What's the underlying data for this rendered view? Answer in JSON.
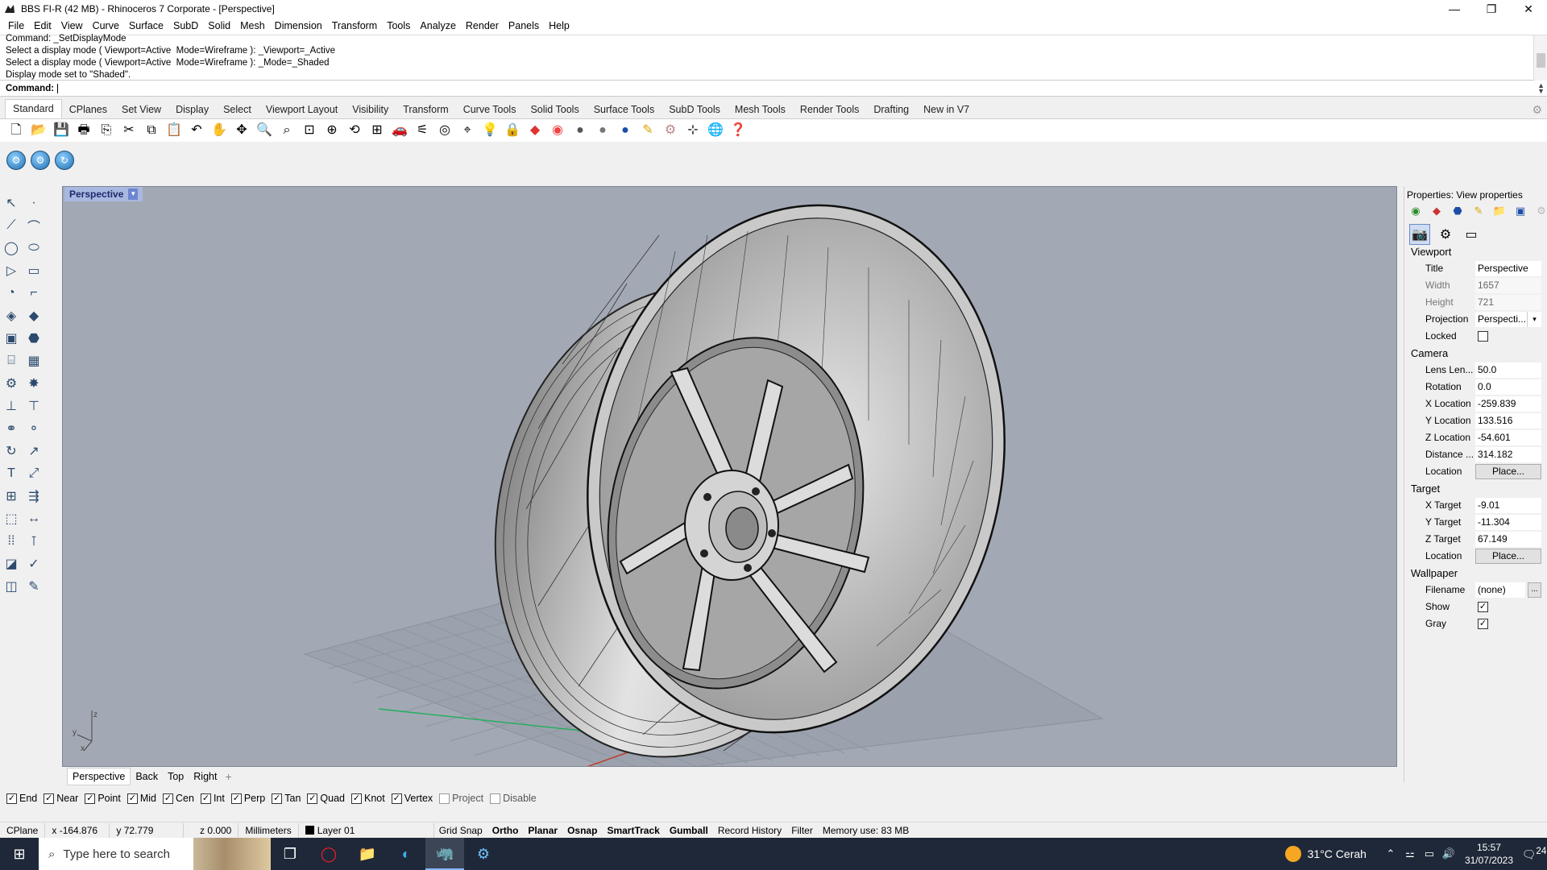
{
  "window": {
    "title": "BBS FI-R (42 MB) - Rhinoceros 7 Corporate - [Perspective]",
    "minimize": "—",
    "maximize": "❐",
    "close": "✕"
  },
  "menu": [
    "File",
    "Edit",
    "View",
    "Curve",
    "Surface",
    "SubD",
    "Solid",
    "Mesh",
    "Dimension",
    "Transform",
    "Tools",
    "Analyze",
    "Render",
    "Panels",
    "Help"
  ],
  "command_history": [
    "Command: _SetDisplayMode",
    "Select a display mode ( Viewport=Active  Mode=Wireframe ): _Viewport=_Active",
    "Select a display mode ( Viewport=Active  Mode=Wireframe ): _Mode=_Shaded",
    "Display mode set to \"Shaded\"."
  ],
  "command_prompt": "Command:",
  "toolbar_tabs": [
    "Standard",
    "CPlanes",
    "Set View",
    "Display",
    "Select",
    "Viewport Layout",
    "Visibility",
    "Transform",
    "Curve Tools",
    "Solid Tools",
    "Surface Tools",
    "SubD Tools",
    "Mesh Tools",
    "Render Tools",
    "Drafting",
    "New in V7"
  ],
  "active_tab": "Standard",
  "toolbar_icons": [
    "new-file-icon",
    "open-icon",
    "save-icon",
    "print-icon",
    "import-icon",
    "cut-icon",
    "copy-icon",
    "paste-icon",
    "undo-icon",
    "pan-icon",
    "rotate-view-icon",
    "zoom-icon",
    "zoom-window-icon",
    "zoom-extents-icon",
    "zoom-selected-icon",
    "undo-view-icon",
    "four-viewports-icon",
    "car-icon",
    "options-icon",
    "history-icon",
    "snap-icon",
    "light-icon",
    "lock-icon",
    "material-icon",
    "color-wheel-icon",
    "sphere-icon",
    "shaded-sphere-icon",
    "rendered-sphere-icon",
    "render-icon",
    "settings-icon",
    "gumball-icon",
    "globe-icon",
    "help-icon"
  ],
  "viewport": {
    "title": "Perspective",
    "axis_z": "z",
    "axis_y": "y",
    "axis_x": "x"
  },
  "viewport_tabs": [
    "Perspective",
    "Back",
    "Top",
    "Right"
  ],
  "viewport_add": "+",
  "osnaps": [
    {
      "label": "End",
      "checked": true
    },
    {
      "label": "Near",
      "checked": true
    },
    {
      "label": "Point",
      "checked": true
    },
    {
      "label": "Mid",
      "checked": true
    },
    {
      "label": "Cen",
      "checked": true
    },
    {
      "label": "Int",
      "checked": true
    },
    {
      "label": "Perp",
      "checked": true
    },
    {
      "label": "Tan",
      "checked": true
    },
    {
      "label": "Quad",
      "checked": true
    },
    {
      "label": "Knot",
      "checked": true
    },
    {
      "label": "Vertex",
      "checked": true
    },
    {
      "label": "Project",
      "checked": false
    },
    {
      "label": "Disable",
      "checked": false
    }
  ],
  "status": {
    "cplane": "CPlane",
    "x": "x -164.876",
    "y": "y 72.779",
    "z": "z 0.000",
    "units": "Millimeters",
    "layer": "Layer 01",
    "grid_snap": "Grid Snap",
    "ortho": "Ortho",
    "planar": "Planar",
    "osnap": "Osnap",
    "smarttrack": "SmartTrack",
    "gumball": "Gumball",
    "record_history": "Record History",
    "filter": "Filter",
    "memory": "Memory use: 83 MB"
  },
  "properties": {
    "title": "Properties: View properties",
    "viewport_section": "Viewport",
    "camera_section": "Camera",
    "target_section": "Target",
    "wallpaper_section": "Wallpaper",
    "fields": {
      "title_label": "Title",
      "title_value": "Perspective",
      "width_label": "Width",
      "width_value": "1657",
      "height_label": "Height",
      "height_value": "721",
      "projection_label": "Projection",
      "projection_value": "Perspecti...",
      "locked_label": "Locked",
      "lens_label": "Lens Len...",
      "lens_value": "50.0",
      "rotation_label": "Rotation",
      "rotation_value": "0.0",
      "xloc_label": "X Location",
      "xloc_value": "-259.839",
      "yloc_label": "Y Location",
      "yloc_value": "133.516",
      "zloc_label": "Z Location",
      "zloc_value": "-54.601",
      "distance_label": "Distance ...",
      "distance_value": "314.182",
      "location_label": "Location",
      "place_button": "Place...",
      "xtarget_label": "X Target",
      "xtarget_value": "-9.01",
      "ytarget_label": "Y Target",
      "ytarget_value": "-11.304",
      "ztarget_label": "Z Target",
      "ztarget_value": "67.149",
      "tlocation_label": "Location",
      "tplace_button": "Place...",
      "filename_label": "Filename",
      "filename_value": "(none)",
      "browse_button": "...",
      "show_label": "Show",
      "gray_label": "Gray"
    }
  },
  "taskbar": {
    "search_placeholder": "Type here to search",
    "weather": "31°C  Cerah",
    "time": "15:57",
    "date": "31/07/2023",
    "notifications": "24"
  }
}
